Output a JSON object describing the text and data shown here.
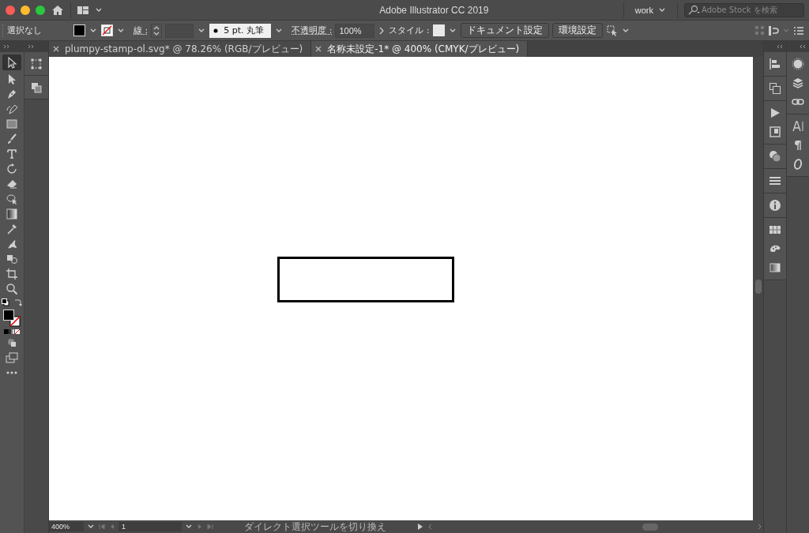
{
  "window": {
    "title": "Adobe Illustrator CC 2019",
    "workspace": "work",
    "search": {
      "placeholder": "Adobe Stock を検索"
    }
  },
  "control_bar": {
    "selection": "選択なし",
    "stroke_label": "線 :",
    "brush": "5 pt. 丸筆",
    "opacity_label": "不透明度 :",
    "opacity": "100%",
    "style_label": "スタイル :",
    "buttons": [
      "ドキュメント設定",
      "環境設定"
    ]
  },
  "tabs": [
    {
      "label": "plumpy-stamp-ol.svg* @ 78.26% (RGB/プレビュー)",
      "selected": false
    },
    {
      "label": "名称未設定-1* @ 400% (CMYK/プレビュー)",
      "selected": true
    }
  ],
  "tools": [
    {
      "selected": true
    },
    {
      "selected": false
    },
    {
      "selected": false
    },
    {
      "selected": false
    },
    {
      "selected": false
    },
    {
      "selected": false
    },
    {
      "selected": false
    },
    {
      "selected": false
    },
    {
      "selected": false
    },
    {
      "selected": false
    },
    {
      "selected": false
    },
    {
      "selected": false
    },
    {
      "selected": false
    },
    {
      "selected": false
    },
    {
      "selected": false
    },
    {
      "selected": false
    }
  ],
  "status_bar": {
    "zoom": "400%",
    "artboard": "1",
    "message": "ダイレクト選択ツールを切り換え"
  }
}
